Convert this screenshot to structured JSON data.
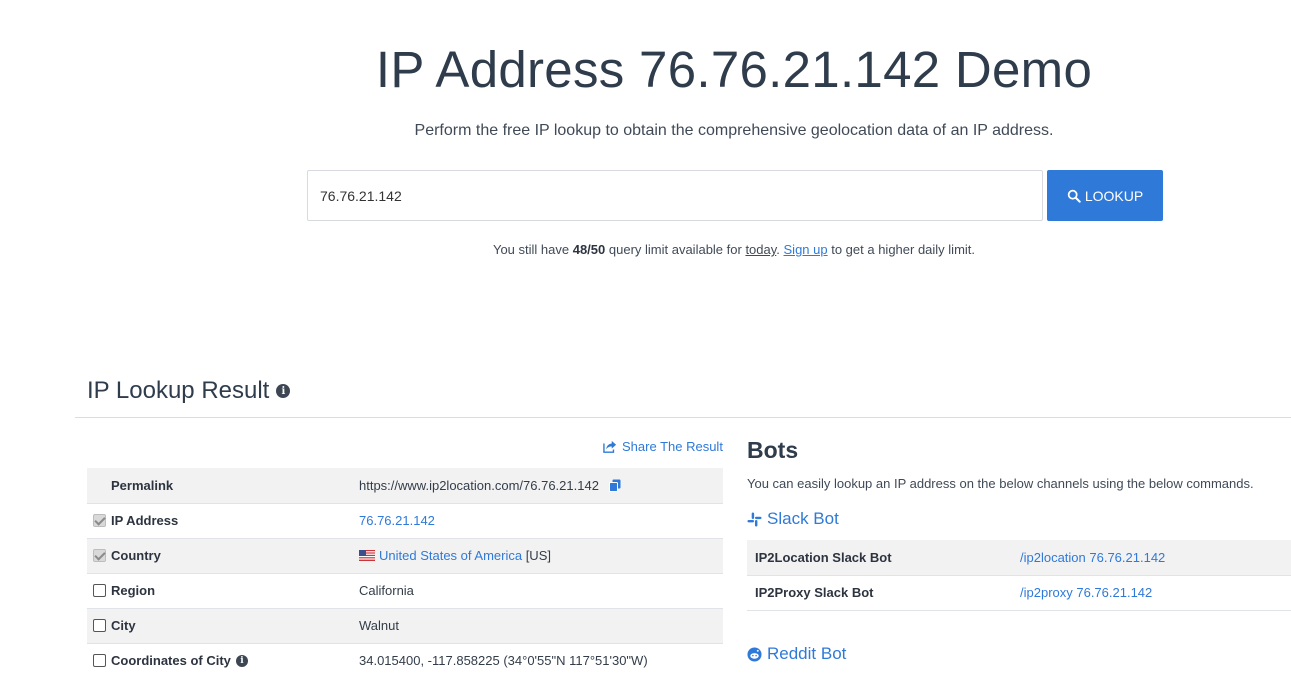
{
  "hero": {
    "title": "IP Address 76.76.21.142 Demo",
    "subtitle": "Perform the free IP lookup to obtain the comprehensive geolocation data of an IP address."
  },
  "search": {
    "value": "76.76.21.142",
    "button_label": "LOOKUP"
  },
  "limit": {
    "prefix": "You still have ",
    "count": "48/50",
    "middle": " query limit available for ",
    "today": "today",
    "period": ". ",
    "signup": "Sign up",
    "suffix": " to get a higher daily limit."
  },
  "result": {
    "title": "IP Lookup Result",
    "share_label": "Share The Result",
    "rows": [
      {
        "key": "Permalink",
        "value": "https://www.ip2location.com/76.76.21.142",
        "checkbox": "none"
      },
      {
        "key": "IP Address",
        "value": "76.76.21.142",
        "checkbox": "checked"
      },
      {
        "key": "Country",
        "value": "United States of America",
        "value_suffix": " [US]",
        "checkbox": "checked"
      },
      {
        "key": "Region",
        "value": "California",
        "checkbox": "unchecked"
      },
      {
        "key": "City",
        "value": "Walnut",
        "checkbox": "unchecked"
      },
      {
        "key": "Coordinates of City",
        "value": "34.015400, -117.858225 (34°0'55\"N   117°51'30\"W)",
        "checkbox": "unchecked"
      }
    ]
  },
  "bots": {
    "title": "Bots",
    "description": "You can easily lookup an IP address on the below channels using the below commands.",
    "slack": {
      "title": "Slack Bot",
      "rows": [
        {
          "key": "IP2Location Slack Bot",
          "value": "/ip2location 76.76.21.142"
        },
        {
          "key": "IP2Proxy Slack Bot",
          "value": "/ip2proxy 76.76.21.142"
        }
      ]
    },
    "reddit": {
      "title": "Reddit Bot"
    }
  },
  "colors": {
    "accent": "#2f7ad8",
    "heading": "#2f3c4c",
    "row_stripe": "#f2f2f2"
  }
}
